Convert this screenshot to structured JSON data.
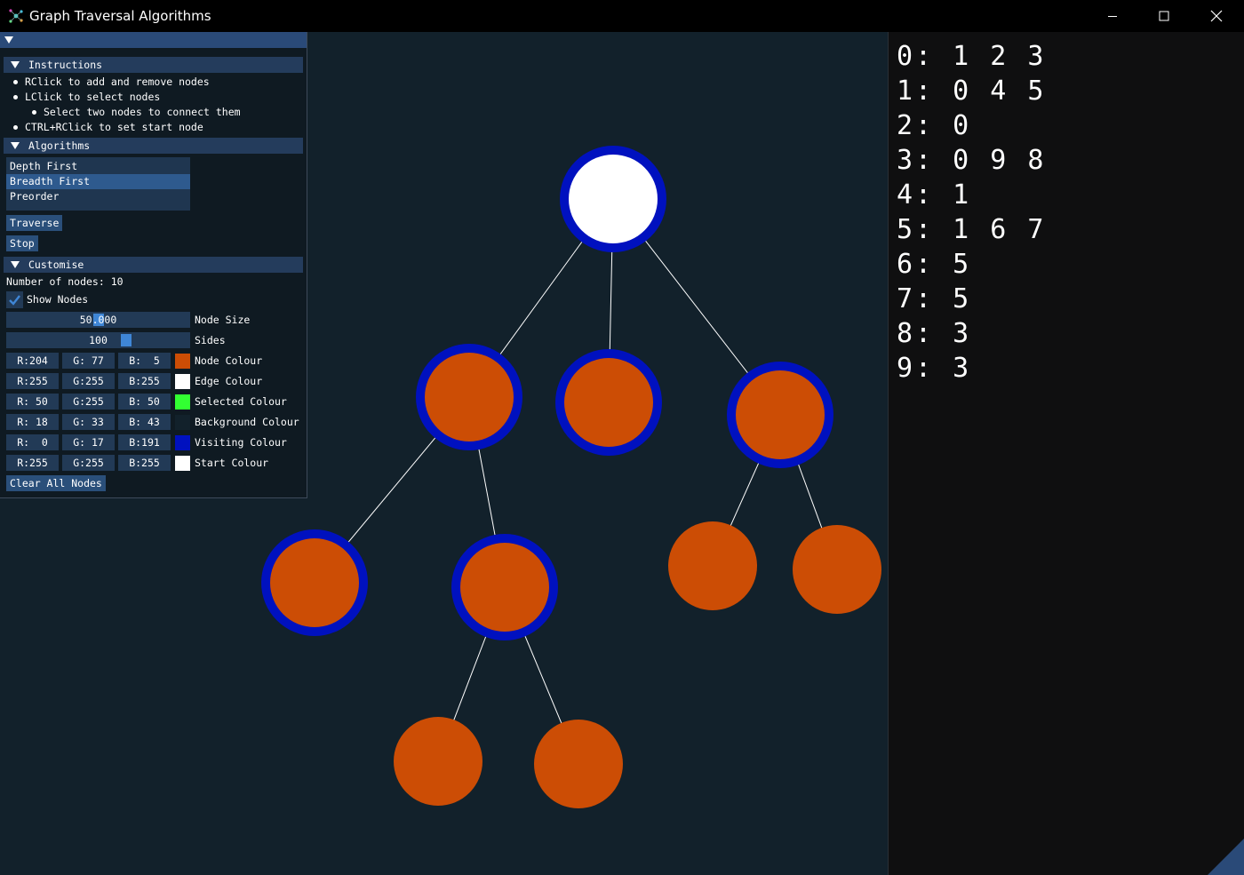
{
  "window": {
    "title": "Graph Traversal Algorithms"
  },
  "colors": {
    "title_bg": "#000000",
    "canvas_bg": "#12212b",
    "panel_bg": "#0f1a22",
    "header_bg": "#243c5c",
    "button_bg": "#2a4f7a",
    "accent": "#3f86d6"
  },
  "instructions": {
    "header": "Instructions",
    "lines": [
      "RClick to add and remove nodes",
      "LClick to select nodes",
      "Select two nodes to connect them",
      "CTRL+RClick to set start node"
    ]
  },
  "algorithms": {
    "header": "Algorithms",
    "items": [
      "Depth First",
      "Breadth First",
      "Preorder"
    ],
    "selected_index": 1,
    "traverse_label": "Traverse",
    "stop_label": "Stop"
  },
  "customise": {
    "header": "Customise",
    "node_count_text": "Number of nodes: 10",
    "show_nodes_label": "Show Nodes",
    "show_nodes_checked": true,
    "node_size": {
      "value_text": "50.000",
      "label": "Node Size",
      "fraction": 0.5
    },
    "sides": {
      "value_text": "100",
      "label": "Sides",
      "fraction": 0.66
    },
    "color_rows": [
      {
        "r": "R:204",
        "g": "G: 77",
        "b": "B:  5",
        "label": "Node Colour",
        "hex": "#cc4d05"
      },
      {
        "r": "R:255",
        "g": "G:255",
        "b": "B:255",
        "label": "Edge Colour",
        "hex": "#ffffff"
      },
      {
        "r": "R: 50",
        "g": "G:255",
        "b": "B: 50",
        "label": "Selected Colour",
        "hex": "#32ff32"
      },
      {
        "r": "R: 18",
        "g": "G: 33",
        "b": "B: 43",
        "label": "Background Colour",
        "hex": "#12212b"
      },
      {
        "r": "R:  0",
        "g": "G: 17",
        "b": "B:191",
        "label": "Visiting Colour",
        "hex": "#0011bf"
      },
      {
        "r": "R:255",
        "g": "G:255",
        "b": "B:255",
        "label": "Start Colour",
        "hex": "#ffffff"
      }
    ],
    "clear_label": "Clear All Nodes"
  },
  "graph": {
    "node_color": "#cc4d05",
    "start_color": "#ffffff",
    "visiting_color": "#0011bf",
    "edge_color": "#ffffff",
    "start_node": 0,
    "visited_nodes": [
      0,
      1,
      2,
      3,
      4,
      5
    ]
  },
  "adjacency": [
    "0: 1 2 3",
    "1: 0 4 5",
    "2: 0",
    "3: 0 9 8",
    "4: 1",
    "5: 1 6 7",
    "6: 5",
    "7: 5",
    "8: 3",
    "9: 3"
  ]
}
